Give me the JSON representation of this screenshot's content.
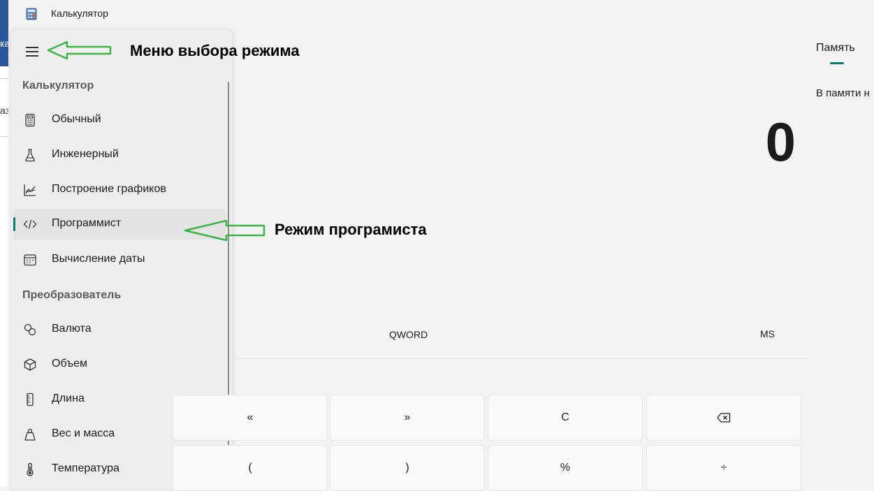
{
  "titlebar": {
    "app_title": "Калькулятор"
  },
  "left_strip": {
    "text_top": "ка",
    "text_mid": "аз"
  },
  "nav": {
    "section_calculator": "Калькулятор",
    "section_converter": "Преобразователь",
    "items": [
      {
        "label": "Обычный",
        "icon": "calculator-icon"
      },
      {
        "label": "Инженерный",
        "icon": "flask-icon"
      },
      {
        "label": "Построение графиков",
        "icon": "graph-icon"
      },
      {
        "label": "Программист",
        "icon": "code-icon",
        "selected": true
      },
      {
        "label": "Вычисление даты",
        "icon": "calendar-icon"
      },
      {
        "label": "Валюта",
        "icon": "currency-icon"
      },
      {
        "label": "Объем",
        "icon": "cube-icon"
      },
      {
        "label": "Длина",
        "icon": "ruler-icon"
      },
      {
        "label": "Вес и масса",
        "icon": "weight-icon"
      },
      {
        "label": "Температура",
        "icon": "thermometer-icon"
      }
    ]
  },
  "annotations": {
    "menu_label": "Меню выбора режима",
    "programmer_label": "Режим програмиста"
  },
  "memory": {
    "tab_label": "Память",
    "empty_text": "В памяти н"
  },
  "display": {
    "value": "0"
  },
  "word_size": "QWORD",
  "memory_store": "MS",
  "keys": {
    "row1": [
      "«",
      "»",
      "C",
      "backspace-icon"
    ],
    "row2": [
      "(",
      ")",
      "%",
      "÷"
    ]
  },
  "colors": {
    "accent": "#0f7b6c",
    "annotation_arrow": "#3fb24a"
  }
}
